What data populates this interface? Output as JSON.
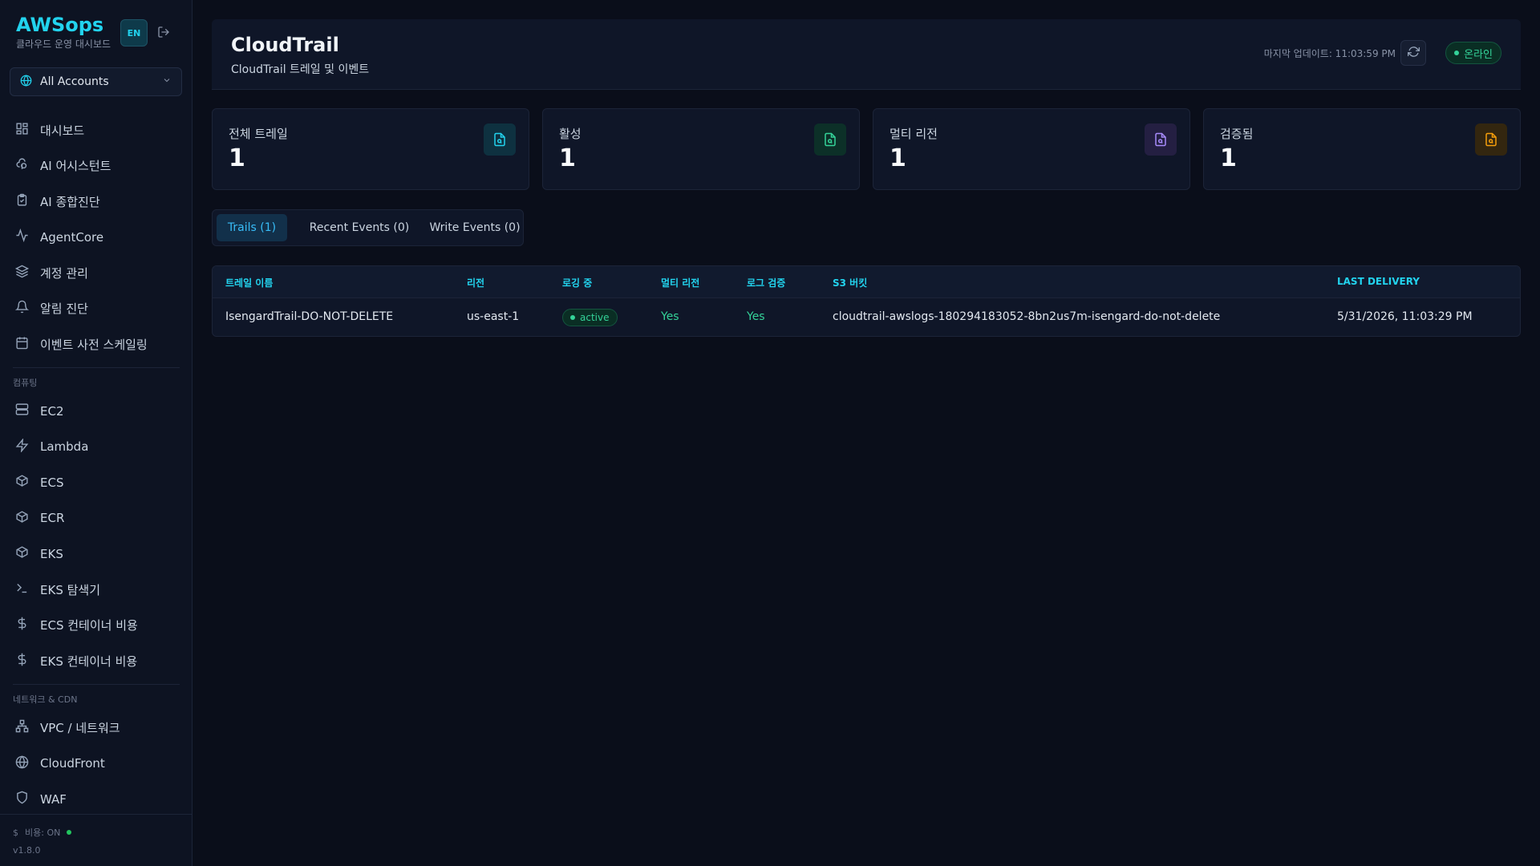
{
  "brand": {
    "title": "AWSops",
    "subtitle": "클라우드 운영 대시보드",
    "lang": "EN"
  },
  "account_select": {
    "value": "All Accounts"
  },
  "nav": {
    "main": [
      {
        "label": "대시보드",
        "icon": "dashboard-icon"
      },
      {
        "label": "AI 어시스턴트",
        "icon": "ai-assistant-icon"
      },
      {
        "label": "AI 종합진단",
        "icon": "clipboard-check-icon"
      },
      {
        "label": "AgentCore",
        "icon": "activity-icon"
      },
      {
        "label": "계정 관리",
        "icon": "layers-icon"
      },
      {
        "label": "알림 진단",
        "icon": "bell-icon"
      },
      {
        "label": "이벤트 사전 스케일링",
        "icon": "calendar-icon"
      }
    ],
    "compute_section": "컴퓨팅",
    "compute": [
      {
        "label": "EC2",
        "icon": "server-icon"
      },
      {
        "label": "Lambda",
        "icon": "zap-icon"
      },
      {
        "label": "ECS",
        "icon": "box-icon"
      },
      {
        "label": "ECR",
        "icon": "box-icon"
      },
      {
        "label": "EKS",
        "icon": "box-icon"
      },
      {
        "label": "EKS 탐색기",
        "icon": "terminal-icon"
      },
      {
        "label": "ECS 컨테이너 비용",
        "icon": "dollar-icon"
      },
      {
        "label": "EKS 컨테이너 비용",
        "icon": "dollar-icon"
      }
    ],
    "network_section": "네트워크 & CDN",
    "network": [
      {
        "label": "VPC / 네트워크",
        "icon": "network-icon"
      },
      {
        "label": "CloudFront",
        "icon": "globe-icon"
      },
      {
        "label": "WAF",
        "icon": "shield-icon"
      }
    ]
  },
  "footer": {
    "cost_label": "비용: ON",
    "version": "v1.8.0"
  },
  "header": {
    "title": "CloudTrail",
    "subtitle": "CloudTrail 트레일 및 이벤트",
    "last_update": "마지막 업데이트: 11:03:59 PM",
    "status": "온라인"
  },
  "stats": [
    {
      "label": "전체 트레일",
      "value": "1",
      "color": "#22d3ee",
      "bg": "#0e3140"
    },
    {
      "label": "활성",
      "value": "1",
      "color": "#34d399",
      "bg": "#0c3028"
    },
    {
      "label": "멀티 리전",
      "value": "1",
      "color": "#a78bfa",
      "bg": "#241f42"
    },
    {
      "label": "검증됨",
      "value": "1",
      "color": "#f59e0b",
      "bg": "#33260f"
    }
  ],
  "tabs": [
    {
      "label": "Trails (1)",
      "active": true
    },
    {
      "label": "Recent Events (0)",
      "active": false
    },
    {
      "label": "Write Events (0)",
      "active": false
    }
  ],
  "table": {
    "headers": [
      "트레일 이름",
      "리전",
      "로깅 중",
      "멀티 리전",
      "로그 검증",
      "S3 버킷",
      "LAST DELIVERY"
    ],
    "rows": [
      {
        "name": "IsengardTrail-DO-NOT-DELETE",
        "region": "us-east-1",
        "logging": "active",
        "multi_region": "Yes",
        "log_validation": "Yes",
        "bucket": "cloudtrail-awslogs-180294183052-8bn2us7m-isengard-do-not-delete",
        "last_delivery": "5/31/2026, 11:03:29 PM"
      }
    ]
  }
}
